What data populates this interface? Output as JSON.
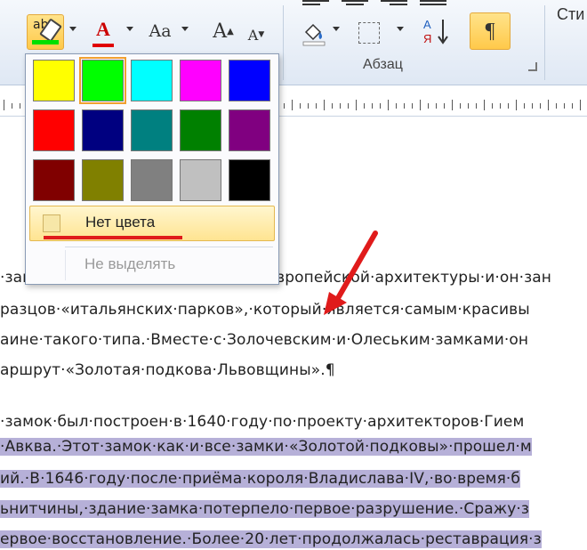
{
  "ribbon": {
    "highlight_button_icon": "text-highlight-color-icon",
    "highlight_current_color": "#00e000",
    "font_color_glyph": "A",
    "font_color_current": "#e00000",
    "change_case_glyph": "Aa",
    "grow_font_glyph": "A",
    "shrink_font_glyph": "A",
    "pilcrow_glyph": "¶",
    "sort_glyph": "А\nЯ",
    "paragraph_group_label": "Абзац",
    "styles_label": "Сти"
  },
  "highlight_menu": {
    "colors": [
      {
        "name": "yellow",
        "hex": "#ffff00"
      },
      {
        "name": "bright-green",
        "hex": "#00ff00",
        "selected": true
      },
      {
        "name": "turquoise",
        "hex": "#00ffff"
      },
      {
        "name": "pink",
        "hex": "#ff00ff"
      },
      {
        "name": "blue",
        "hex": "#0000ff"
      },
      {
        "name": "red",
        "hex": "#ff0000"
      },
      {
        "name": "dark-blue",
        "hex": "#000080"
      },
      {
        "name": "teal",
        "hex": "#008080"
      },
      {
        "name": "green",
        "hex": "#008000"
      },
      {
        "name": "violet",
        "hex": "#800080"
      },
      {
        "name": "dark-red",
        "hex": "#800000"
      },
      {
        "name": "dark-yellow",
        "hex": "#808000"
      },
      {
        "name": "gray-50",
        "hex": "#808080"
      },
      {
        "name": "gray-25",
        "hex": "#c0c0c0"
      },
      {
        "name": "black",
        "hex": "#000000"
      }
    ],
    "no_color_label": "Нет цвета",
    "stop_highlighting_label": "Не выделять"
  },
  "document": {
    "lines": [
      {
        "text": "·зам",
        "selected": false
      },
      {
        "text": "разцов·«итальянских·парков»,·который·является·самым·красивы",
        "selected": false
      },
      {
        "text": "аине·такого·типа.·Вместе·с·Золочевским·и·Олеським·замками·он",
        "selected": false
      },
      {
        "text": "аршрут·«Золотая·подкова·Львовщины».¶",
        "selected": false
      },
      {
        "text": "·замок·был·построен·в·1640·году·по·проекту·архитекторов·Гием",
        "selected": false
      },
      {
        "text": "·Авква.·Этот·замок·как·и·все·замки·«Золотой·подковы»·прошел·м",
        "selected": true
      },
      {
        "text": "ий.·В·1646·году·после·приёма·короля·Владислава·IV,·во·время·б",
        "selected": true
      },
      {
        "text": "ьнитчины,·здание·замка·потерпело·первое·разрушение.·Сражу·з",
        "selected": true
      },
      {
        "text": "ервое·восстановление.·Более·20·лет·продолжалась·реставрация·з",
        "selected": true
      }
    ],
    "first_line_tail": "вропейской·архитектуры·и·он·зан"
  },
  "annotation": {
    "arrow_color": "#e01b1b"
  }
}
